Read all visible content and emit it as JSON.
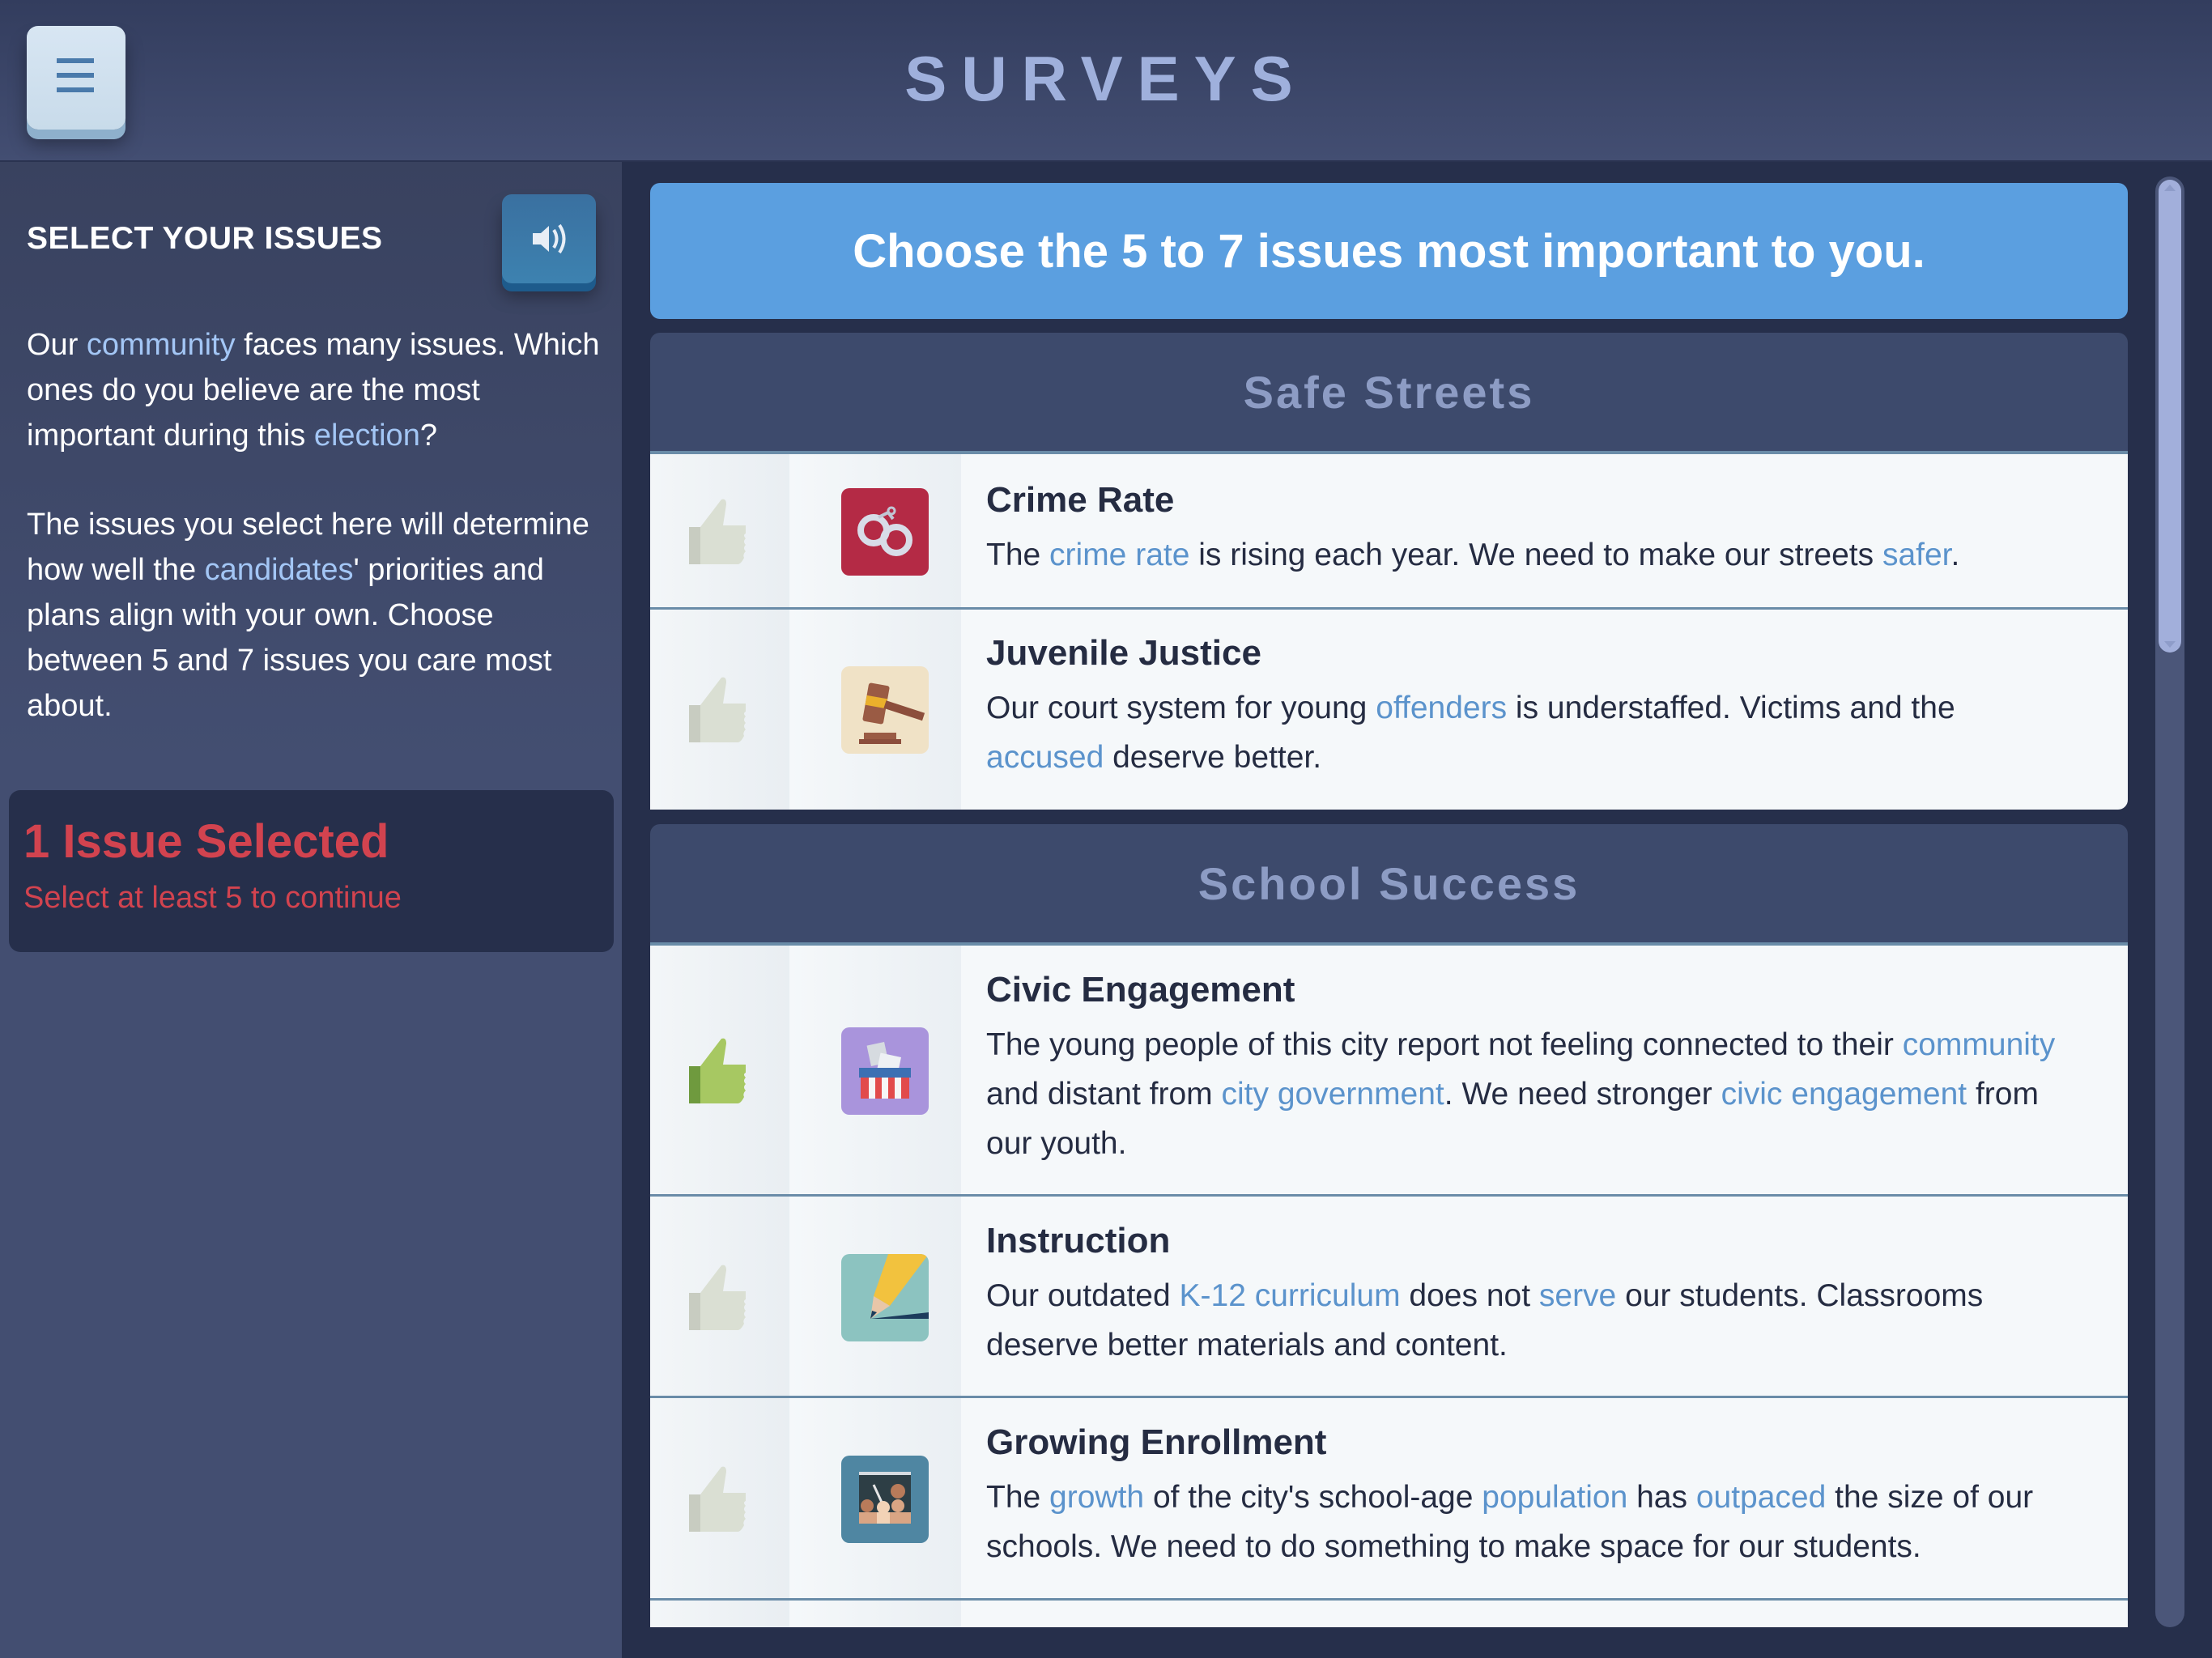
{
  "header": {
    "title": "SURVEYS",
    "menu_icon": "hamburger-menu-icon"
  },
  "sidebar": {
    "title": "SELECT YOUR ISSUES",
    "audio_icon": "speaker-icon",
    "paragraph1": [
      {
        "text": "Our ",
        "kw": false
      },
      {
        "text": "community",
        "kw": true
      },
      {
        "text": " faces many issues. Which ones do you believe are the most important during this ",
        "kw": false
      },
      {
        "text": "election",
        "kw": true
      },
      {
        "text": "?",
        "kw": false
      }
    ],
    "paragraph2": [
      {
        "text": "The issues you select here will determine how well the ",
        "kw": false
      },
      {
        "text": "candidates",
        "kw": true
      },
      {
        "text": "' priorities and plans align with your own. Choose between 5 and 7 issues you care most about.",
        "kw": false
      }
    ],
    "status": {
      "title": "1 Issue Selected",
      "subtitle": "Select at least 5 to continue",
      "color": "#d2434f"
    }
  },
  "main": {
    "banner": "Choose the 5 to 7 issues most important to you.",
    "sections": [
      {
        "title": "Safe Streets",
        "issues": [
          {
            "title": "Crime Rate",
            "icon": "handcuffs-icon",
            "selected": false,
            "desc": [
              {
                "text": "The ",
                "kw": false
              },
              {
                "text": "crime rate",
                "kw": true
              },
              {
                "text": " is rising each year. We need to make our streets ",
                "kw": false
              },
              {
                "text": "safer",
                "kw": true
              },
              {
                "text": ".",
                "kw": false
              }
            ]
          },
          {
            "title": "Juvenile Justice",
            "icon": "gavel-icon",
            "selected": false,
            "desc": [
              {
                "text": "Our court system for young ",
                "kw": false
              },
              {
                "text": "offenders",
                "kw": true
              },
              {
                "text": " is understaffed. Victims and the ",
                "kw": false
              },
              {
                "text": "accused",
                "kw": true
              },
              {
                "text": " deserve better.",
                "kw": false
              }
            ]
          }
        ]
      },
      {
        "title": "School Success",
        "issues": [
          {
            "title": "Civic Engagement",
            "icon": "ballot-box-icon",
            "selected": true,
            "desc": [
              {
                "text": "The young people of this city report not feeling connected to their ",
                "kw": false
              },
              {
                "text": "community",
                "kw": true
              },
              {
                "text": " and distant from ",
                "kw": false
              },
              {
                "text": "city government",
                "kw": true
              },
              {
                "text": ". We need stronger ",
                "kw": false
              },
              {
                "text": "civic engagement",
                "kw": true
              },
              {
                "text": " from our youth.",
                "kw": false
              }
            ]
          },
          {
            "title": "Instruction",
            "icon": "pencil-icon",
            "selected": false,
            "desc": [
              {
                "text": "Our outdated ",
                "kw": false
              },
              {
                "text": "K-12 curriculum",
                "kw": true
              },
              {
                "text": " does not ",
                "kw": false
              },
              {
                "text": "serve",
                "kw": true
              },
              {
                "text": " our students. Classrooms deserve better materials and content.",
                "kw": false
              }
            ]
          },
          {
            "title": "Growing Enrollment",
            "icon": "classroom-icon",
            "selected": false,
            "desc": [
              {
                "text": "The ",
                "kw": false
              },
              {
                "text": "growth",
                "kw": true
              },
              {
                "text": " of the city's school-age ",
                "kw": false
              },
              {
                "text": "population",
                "kw": true
              },
              {
                "text": " has ",
                "kw": false
              },
              {
                "text": "outpaced",
                "kw": true
              },
              {
                "text": " the size of our schools. We need to do something to make space for our students.",
                "kw": false
              }
            ]
          }
        ]
      }
    ]
  },
  "colors": {
    "accent_blue": "#5b9fe0",
    "keyword_light": "#a3c6f5",
    "keyword_dark": "#5b93cc",
    "alert_red": "#d2434f",
    "thumb_selected": "#9cbf5a",
    "thumb_unselected": "#d9ddd2"
  }
}
